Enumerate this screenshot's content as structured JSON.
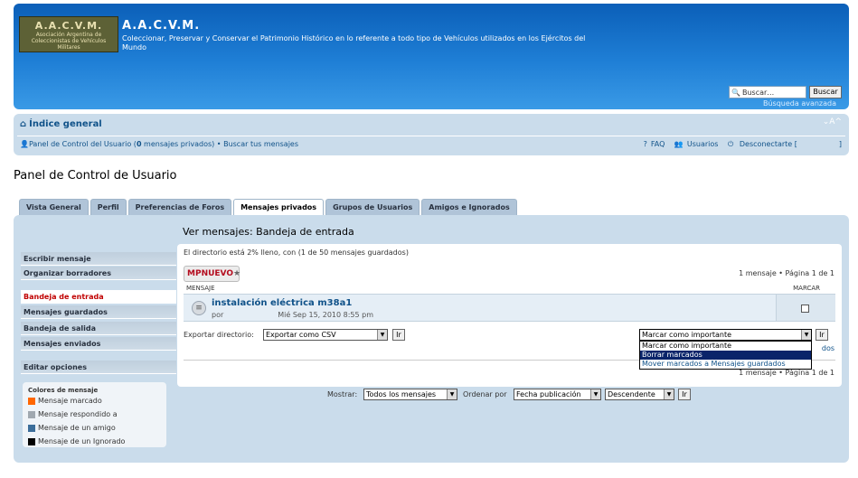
{
  "header": {
    "logo_big": "A.A.C.V.M.",
    "logo_small": "Asociación Argentina de Coleccionistas de Vehículos Militares",
    "title": "A.A.C.V.M.",
    "description": "Coleccionar, Preservar y Conservar el Patrimonio Histórico en lo referente a todo tipo de Vehículos utilizados en los Ejércitos del Mundo",
    "search_placeholder": "Buscar…",
    "search_button": "Buscar",
    "advanced_search": "Búsqueda avanzada"
  },
  "nav": {
    "index": "Índice general",
    "font_change": "⌄A^",
    "control_panel": "Panel de Control del Usuario (",
    "pm_count": "0",
    "pm_suffix": " mensajes privados)",
    "bullet": " • ",
    "search_own": "Buscar tus mensajes",
    "faq": "FAQ",
    "users": "Usuarios",
    "logout": "Desconectarte [",
    "logout_end": "]"
  },
  "page_title": "Panel de Control de Usuario",
  "tabs": [
    {
      "label": "Vista General"
    },
    {
      "label": "Perfil"
    },
    {
      "label": "Preferencias de Foros"
    },
    {
      "label": "Mensajes privados"
    },
    {
      "label": "Grupos de Usuarios"
    },
    {
      "label": "Amigos e Ignorados"
    }
  ],
  "sidebar": {
    "items": [
      {
        "label": "Escribir mensaje"
      },
      {
        "label": "Organizar borradores"
      },
      {
        "label": "Bandeja de entrada"
      },
      {
        "label": "Mensajes guardados"
      },
      {
        "label": "Bandeja de salida"
      },
      {
        "label": "Mensajes enviados"
      },
      {
        "label": "Editar opciones"
      }
    ],
    "legend_title": "Colores de mensaje",
    "legend": [
      {
        "label": "Mensaje marcado",
        "color": "#ff6600"
      },
      {
        "label": "Mensaje respondido a",
        "color": "#a0a8b0"
      },
      {
        "label": "Mensaje de un amigo",
        "color": "#3c6e9a"
      },
      {
        "label": "Mensaje de un Ignorado",
        "color": "#000000"
      }
    ]
  },
  "content": {
    "title": "Ver mensajes: Bandeja de entrada",
    "dir_status": "El directorio está 2% lleno, con (1 de 50 mensajes guardados)",
    "new_pm_mp": "MP",
    "new_pm_label": "NUEVO",
    "pagination": "1 mensaje • Página 1 de 1",
    "col_message": "MENSAJE",
    "col_mark": "MARCAR",
    "message": {
      "subject": "instalación eléctrica m38a1",
      "by": "por",
      "date": "Mié Sep 15, 2010 8:55 pm"
    },
    "export_label": "Exportar directorio:",
    "export_value": "Exportar como CSV",
    "go": "Ir",
    "mark_value": "Marcar como importante",
    "mark_options": [
      "Marcar como importante",
      "Borrar marcados",
      "Mover marcados a Mensajes guardados"
    ],
    "behind_text": "dos"
  },
  "bottom": {
    "show_label": "Mostrar:",
    "show_value": "Todos los mensajes",
    "order_label": "Ordenar por",
    "order_value": "Fecha publicación",
    "dir_value": "Descendente"
  },
  "colors": {
    "header_blue": "#1f7fd6",
    "panel_bg": "#cadceb",
    "link": "#105289",
    "active_red": "#c00000"
  }
}
